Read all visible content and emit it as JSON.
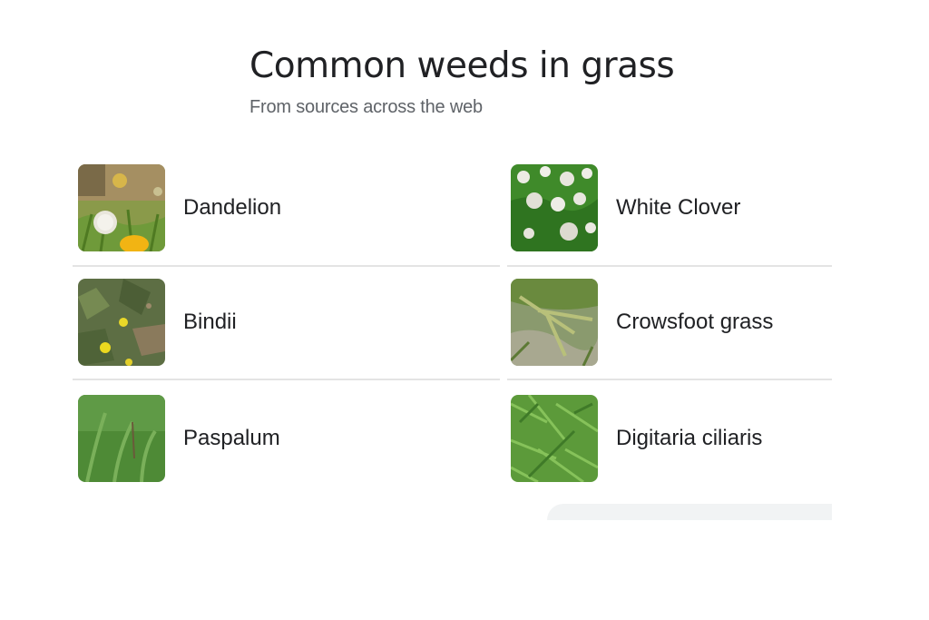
{
  "header": {
    "title": "Common weeds in grass",
    "subtitle": "From sources across the web"
  },
  "items": [
    {
      "label": "Dandelion",
      "icon": "dandelion-photo"
    },
    {
      "label": "White Clover",
      "icon": "white-clover-photo"
    },
    {
      "label": "Bindii",
      "icon": "bindii-photo"
    },
    {
      "label": "Crowsfoot grass",
      "icon": "crowsfoot-grass-photo"
    },
    {
      "label": "Paspalum",
      "icon": "paspalum-photo"
    },
    {
      "label": "Digitaria ciliaris",
      "icon": "digitaria-ciliaris-photo"
    }
  ],
  "colors": {
    "text": "#202124",
    "subtext": "#5f6368",
    "divider": "#e4e4e4",
    "pill": "#f1f3f4"
  }
}
